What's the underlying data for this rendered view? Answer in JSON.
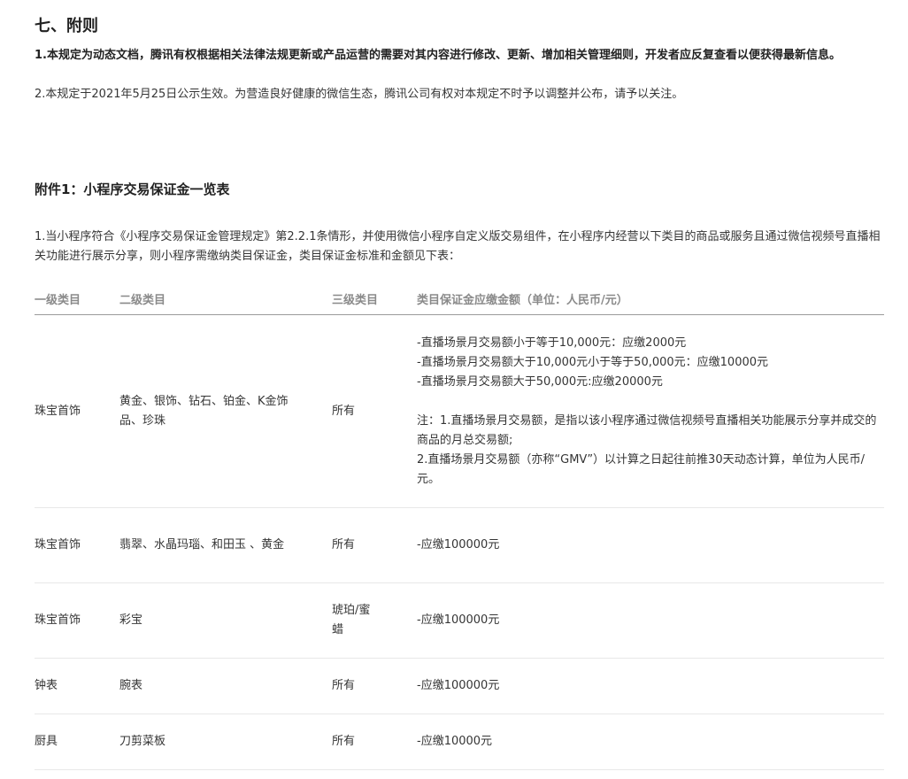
{
  "section": {
    "title": "七、附则",
    "p1": "1.本规定为动态文档，腾讯有权根据相关法律法规更新或产品运营的需要对其内容进行修改、更新、增加相关管理细则，开发者应反复查看以便获得最新信息。",
    "p2": "2.本规定于2021年5月25日公示生效。为营造良好健康的微信生态，腾讯公司有权对本规定不时予以调整并公布，请予以关注。"
  },
  "annex": {
    "title": "附件1：小程序交易保证金一览表",
    "intro": "1.当小程序符合《小程序交易保证金管理规定》第2.2.1条情形，并使用微信小程序自定义版交易组件，在小程序内经营以下类目的商品或服务且通过微信视频号直播相关功能进行展示分享，则小程序需缴纳类目保证金，类目保证金标准和金额见下表："
  },
  "table": {
    "headers": [
      "一级类目",
      "二级类目",
      "三级类目",
      "类目保证金应缴金额（单位：人民币/元）"
    ],
    "rows": [
      {
        "c1": "珠宝首饰",
        "c2": "黄金、银饰、钻石、铂金、K金饰品、珍珠",
        "c3": "所有",
        "c4": [
          "-直播场景月交易额小于等于10,000元：应缴2000元",
          "-直播场景月交易额大于10,000元小于等于50,000元：应缴10000元",
          "-直播场景月交易额大于50,000元:应缴20000元"
        ],
        "c4_notes": [
          "注：1.直播场景月交易额，是指以该小程序通过微信视频号直播相关功能展示分享并成交的商品的月总交易额;",
          "2.直播场景月交易额（亦称“GMV”）以计算之日起往前推30天动态计算，单位为人民币/元。"
        ]
      },
      {
        "c1": "珠宝首饰",
        "c2": "翡翠、水晶玛瑙、和田玉 、黄金",
        "c3": "所有",
        "c4": "-应缴100000元"
      },
      {
        "c1": "珠宝首饰",
        "c2": "彩宝",
        "c3": "琥珀/蜜蜡",
        "c4": "-应缴100000元"
      },
      {
        "c1": "钟表",
        "c2": "腕表",
        "c3": "所有",
        "c4": "-应缴100000元"
      },
      {
        "c1": "厨具",
        "c2": "刀剪菜板",
        "c3": "所有",
        "c4": "-应缴10000元"
      }
    ]
  }
}
